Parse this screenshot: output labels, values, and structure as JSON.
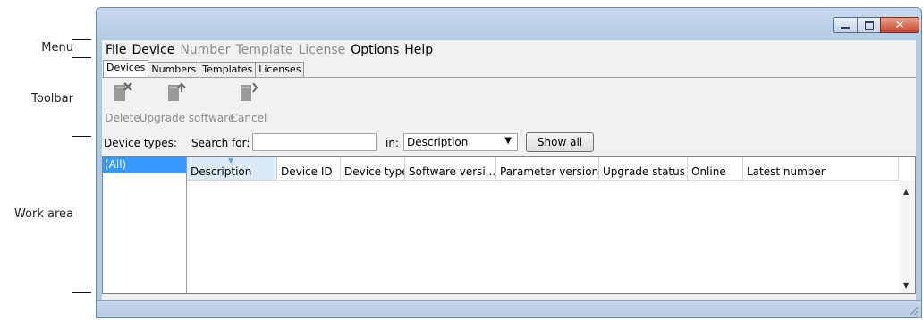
{
  "callouts": [
    {
      "id": "menu",
      "text": "Menu"
    },
    {
      "id": "toolbar",
      "text": "Toolbar"
    },
    {
      "id": "work_area",
      "text": "Work area"
    }
  ],
  "window": {
    "controls": [
      "minimize",
      "maximize",
      "close"
    ]
  },
  "menu": [
    {
      "label": "File",
      "enabled": true
    },
    {
      "label": "Device",
      "enabled": true
    },
    {
      "label": "Number",
      "enabled": false
    },
    {
      "label": "Template",
      "enabled": false
    },
    {
      "label": "License",
      "enabled": false
    },
    {
      "label": "Options",
      "enabled": true
    },
    {
      "label": "Help",
      "enabled": true
    }
  ],
  "tabs": [
    {
      "label": "Devices",
      "active": true
    },
    {
      "label": "Numbers",
      "active": false
    },
    {
      "label": "Templates",
      "active": false
    },
    {
      "label": "Licenses",
      "active": false
    }
  ],
  "toolbar": {
    "delete_label": "Delete",
    "upgrade_label": "Upgrade software",
    "cancel_label": "Cancel"
  },
  "filter": {
    "device_types_label": "Device types:",
    "search_label": "Search for:",
    "search_value": "",
    "in_label": "in:",
    "in_value": "Description",
    "show_all_label": "Show all"
  },
  "device_types": [
    "(All)"
  ],
  "columns": [
    "Description",
    "Device ID",
    "Device type",
    "Software versi...",
    "Parameter version",
    "Upgrade status",
    "Online",
    "Latest number"
  ],
  "colors": {
    "selection": "#3399ff",
    "sorted_header": "#dceaf8",
    "disabled_text": "#8d8d8d",
    "window_frame": "#b2c9e4"
  }
}
